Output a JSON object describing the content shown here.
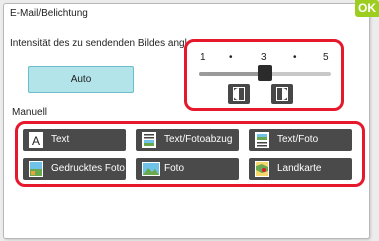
{
  "dialog": {
    "title": "E-Mail/Belichtung",
    "ok_label": "OK",
    "subtitle": "Intensität des zu sendenden Bildes angl",
    "auto_label": "Auto",
    "manual_label": "Manuell"
  },
  "exposure": {
    "scale": [
      "1",
      "•",
      "3",
      "•",
      "5"
    ],
    "value": 3,
    "min": 1,
    "max": 5,
    "lighter_icon": "contrast-lighter-icon",
    "darker_icon": "contrast-darker-icon"
  },
  "modes": [
    {
      "label": "Text",
      "icon": "text-a-icon"
    },
    {
      "label": "Text/Fotoabzug",
      "icon": "text-printed-photo-icon"
    },
    {
      "label": "Text/Foto",
      "icon": "text-photo-icon"
    },
    {
      "label": "Gedrucktes Foto",
      "icon": "printed-photo-icon"
    },
    {
      "label": "Foto",
      "icon": "photo-icon"
    },
    {
      "label": "Landkarte",
      "icon": "map-icon"
    }
  ],
  "colors": {
    "ok": "#9ccd1f",
    "highlight": "#e5182c",
    "auto_bg": "#b2e4ea",
    "button_dark": "#4a4a4a"
  }
}
